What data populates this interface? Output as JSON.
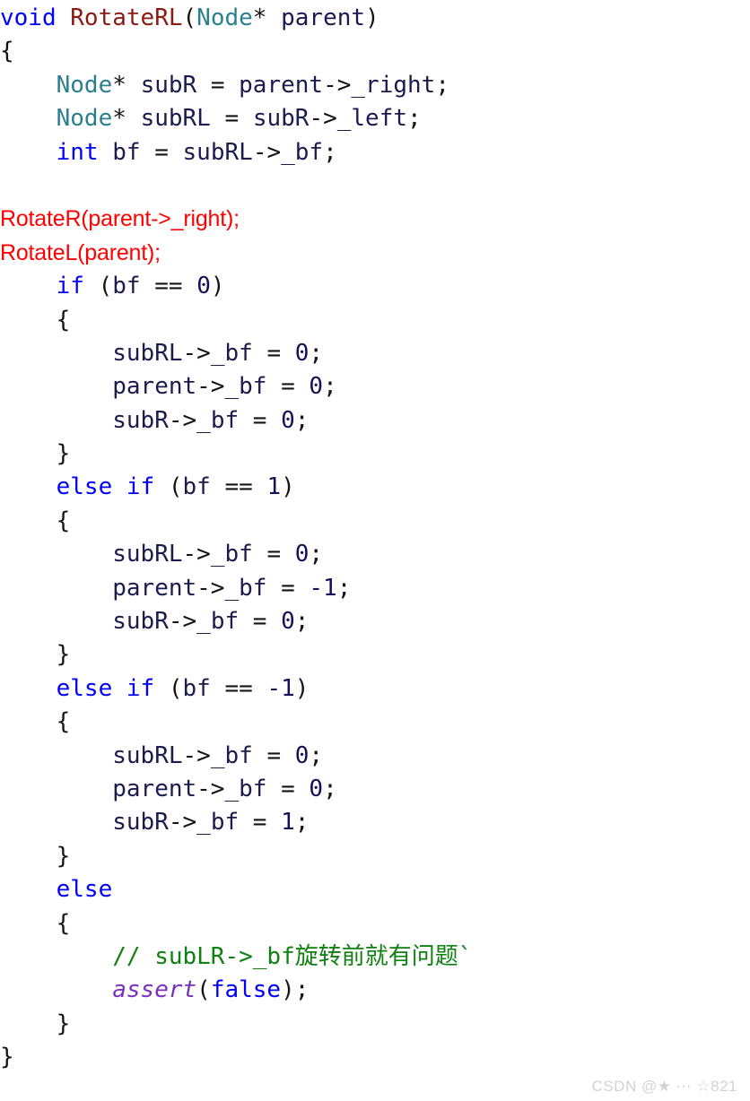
{
  "document": {
    "kind": "code-screenshot",
    "language": "C++",
    "function_name": "RotateRL",
    "background_color": "#ffffff"
  },
  "palette": {
    "keyword": "#0000ff",
    "function_name": "#8b1a12",
    "type_name": "#2b8090",
    "identifier": "#1b1b4f",
    "punctuation": "#141414",
    "number": "#121258",
    "comment": "#108010",
    "macro": "#7b2fbe",
    "annotation_red": "#ff0000",
    "watermark": "#d2d2d2"
  },
  "code": {
    "plain_text": "void RotateRL(Node* parent)\n{\n    Node* subR = parent->_right;\n    Node* subRL = subR->_left;\n    int bf = subRL->_bf;\n\n    RotateR(parent->_right);\n    RotateL(parent);\n    if (bf == 0)\n    {\n        subRL->_bf = 0;\n        parent->_bf = 0;\n        subR->_bf = 0;\n    }\n    else if (bf == 1)\n    {\n        subRL->_bf = 0;\n        parent->_bf = -1;\n        subR->_bf = 0;\n    }\n    else if (bf == -1)\n    {\n        subRL->_bf = 0;\n        parent->_bf = 0;\n        subR->_bf = 1;\n    }\n    else\n    {\n        // subLR->_bf旋转前就有问题`\n        assert(false);\n    }\n}",
    "lines": [
      {
        "n": 1,
        "style": "code",
        "tokens": [
          {
            "t": "void",
            "c": "kw"
          },
          {
            "t": " ",
            "c": "punct"
          },
          {
            "t": "RotateRL",
            "c": "fn"
          },
          {
            "t": "(",
            "c": "punct"
          },
          {
            "t": "Node",
            "c": "type"
          },
          {
            "t": "* ",
            "c": "punct"
          },
          {
            "t": "parent",
            "c": "ident"
          },
          {
            "t": ")",
            "c": "punct"
          }
        ]
      },
      {
        "n": 2,
        "style": "code",
        "tokens": [
          {
            "t": "{",
            "c": "punct"
          }
        ]
      },
      {
        "n": 3,
        "style": "code",
        "tokens": [
          {
            "t": "    ",
            "c": "punct"
          },
          {
            "t": "Node",
            "c": "type"
          },
          {
            "t": "* ",
            "c": "punct"
          },
          {
            "t": "subR",
            "c": "ident"
          },
          {
            "t": " = ",
            "c": "punct"
          },
          {
            "t": "parent",
            "c": "ident"
          },
          {
            "t": "->",
            "c": "punct"
          },
          {
            "t": "_right",
            "c": "ident"
          },
          {
            "t": ";",
            "c": "punct"
          }
        ]
      },
      {
        "n": 4,
        "style": "code",
        "tokens": [
          {
            "t": "    ",
            "c": "punct"
          },
          {
            "t": "Node",
            "c": "type"
          },
          {
            "t": "* ",
            "c": "punct"
          },
          {
            "t": "subRL",
            "c": "ident"
          },
          {
            "t": " = ",
            "c": "punct"
          },
          {
            "t": "subR",
            "c": "ident"
          },
          {
            "t": "->",
            "c": "punct"
          },
          {
            "t": "_left",
            "c": "ident"
          },
          {
            "t": ";",
            "c": "punct"
          }
        ]
      },
      {
        "n": 5,
        "style": "code",
        "tokens": [
          {
            "t": "    ",
            "c": "punct"
          },
          {
            "t": "int",
            "c": "kw"
          },
          {
            "t": " ",
            "c": "punct"
          },
          {
            "t": "bf",
            "c": "ident"
          },
          {
            "t": " = ",
            "c": "punct"
          },
          {
            "t": "subRL",
            "c": "ident"
          },
          {
            "t": "->",
            "c": "punct"
          },
          {
            "t": "_bf",
            "c": "ident"
          },
          {
            "t": ";",
            "c": "punct"
          }
        ]
      },
      {
        "n": 6,
        "style": "blank",
        "tokens": [
          {
            "t": " ",
            "c": "punct"
          }
        ]
      },
      {
        "n": 7,
        "style": "annotation",
        "tokens": [
          {
            "t": "RotateR(parent->_right);",
            "c": "red"
          }
        ]
      },
      {
        "n": 8,
        "style": "annotation",
        "tokens": [
          {
            "t": "RotateL(parent);",
            "c": "red"
          }
        ]
      },
      {
        "n": 9,
        "style": "code",
        "tokens": [
          {
            "t": "    ",
            "c": "punct"
          },
          {
            "t": "if",
            "c": "kw"
          },
          {
            "t": " (",
            "c": "punct"
          },
          {
            "t": "bf",
            "c": "ident"
          },
          {
            "t": " == ",
            "c": "punct"
          },
          {
            "t": "0",
            "c": "num"
          },
          {
            "t": ")",
            "c": "punct"
          }
        ]
      },
      {
        "n": 10,
        "style": "code",
        "tokens": [
          {
            "t": "    {",
            "c": "punct"
          }
        ]
      },
      {
        "n": 11,
        "style": "code",
        "tokens": [
          {
            "t": "        ",
            "c": "punct"
          },
          {
            "t": "subRL",
            "c": "ident"
          },
          {
            "t": "->",
            "c": "punct"
          },
          {
            "t": "_bf",
            "c": "ident"
          },
          {
            "t": " = ",
            "c": "punct"
          },
          {
            "t": "0",
            "c": "num"
          },
          {
            "t": ";",
            "c": "punct"
          }
        ]
      },
      {
        "n": 12,
        "style": "code",
        "tokens": [
          {
            "t": "        ",
            "c": "punct"
          },
          {
            "t": "parent",
            "c": "ident"
          },
          {
            "t": "->",
            "c": "punct"
          },
          {
            "t": "_bf",
            "c": "ident"
          },
          {
            "t": " = ",
            "c": "punct"
          },
          {
            "t": "0",
            "c": "num"
          },
          {
            "t": ";",
            "c": "punct"
          }
        ]
      },
      {
        "n": 13,
        "style": "code",
        "tokens": [
          {
            "t": "        ",
            "c": "punct"
          },
          {
            "t": "subR",
            "c": "ident"
          },
          {
            "t": "->",
            "c": "punct"
          },
          {
            "t": "_bf",
            "c": "ident"
          },
          {
            "t": " = ",
            "c": "punct"
          },
          {
            "t": "0",
            "c": "num"
          },
          {
            "t": ";",
            "c": "punct"
          }
        ]
      },
      {
        "n": 14,
        "style": "code",
        "tokens": [
          {
            "t": "    }",
            "c": "punct"
          }
        ]
      },
      {
        "n": 15,
        "style": "code",
        "tokens": [
          {
            "t": "    ",
            "c": "punct"
          },
          {
            "t": "else if",
            "c": "kw"
          },
          {
            "t": " (",
            "c": "punct"
          },
          {
            "t": "bf",
            "c": "ident"
          },
          {
            "t": " == ",
            "c": "punct"
          },
          {
            "t": "1",
            "c": "num"
          },
          {
            "t": ")",
            "c": "punct"
          }
        ]
      },
      {
        "n": 16,
        "style": "code",
        "tokens": [
          {
            "t": "    {",
            "c": "punct"
          }
        ]
      },
      {
        "n": 17,
        "style": "code",
        "tokens": [
          {
            "t": "        ",
            "c": "punct"
          },
          {
            "t": "subRL",
            "c": "ident"
          },
          {
            "t": "->",
            "c": "punct"
          },
          {
            "t": "_bf",
            "c": "ident"
          },
          {
            "t": " = ",
            "c": "punct"
          },
          {
            "t": "0",
            "c": "num"
          },
          {
            "t": ";",
            "c": "punct"
          }
        ]
      },
      {
        "n": 18,
        "style": "code",
        "tokens": [
          {
            "t": "        ",
            "c": "punct"
          },
          {
            "t": "parent",
            "c": "ident"
          },
          {
            "t": "->",
            "c": "punct"
          },
          {
            "t": "_bf",
            "c": "ident"
          },
          {
            "t": " = ",
            "c": "punct"
          },
          {
            "t": "-1",
            "c": "num"
          },
          {
            "t": ";",
            "c": "punct"
          }
        ]
      },
      {
        "n": 19,
        "style": "code",
        "tokens": [
          {
            "t": "        ",
            "c": "punct"
          },
          {
            "t": "subR",
            "c": "ident"
          },
          {
            "t": "->",
            "c": "punct"
          },
          {
            "t": "_bf",
            "c": "ident"
          },
          {
            "t": " = ",
            "c": "punct"
          },
          {
            "t": "0",
            "c": "num"
          },
          {
            "t": ";",
            "c": "punct"
          }
        ]
      },
      {
        "n": 20,
        "style": "code",
        "tokens": [
          {
            "t": "    }",
            "c": "punct"
          }
        ]
      },
      {
        "n": 21,
        "style": "code",
        "tokens": [
          {
            "t": "    ",
            "c": "punct"
          },
          {
            "t": "else if",
            "c": "kw"
          },
          {
            "t": " (",
            "c": "punct"
          },
          {
            "t": "bf",
            "c": "ident"
          },
          {
            "t": " == ",
            "c": "punct"
          },
          {
            "t": "-1",
            "c": "num"
          },
          {
            "t": ")",
            "c": "punct"
          }
        ]
      },
      {
        "n": 22,
        "style": "code",
        "tokens": [
          {
            "t": "    {",
            "c": "punct"
          }
        ]
      },
      {
        "n": 23,
        "style": "code",
        "tokens": [
          {
            "t": "        ",
            "c": "punct"
          },
          {
            "t": "subRL",
            "c": "ident"
          },
          {
            "t": "->",
            "c": "punct"
          },
          {
            "t": "_bf",
            "c": "ident"
          },
          {
            "t": " = ",
            "c": "punct"
          },
          {
            "t": "0",
            "c": "num"
          },
          {
            "t": ";",
            "c": "punct"
          }
        ]
      },
      {
        "n": 24,
        "style": "code",
        "tokens": [
          {
            "t": "        ",
            "c": "punct"
          },
          {
            "t": "parent",
            "c": "ident"
          },
          {
            "t": "->",
            "c": "punct"
          },
          {
            "t": "_bf",
            "c": "ident"
          },
          {
            "t": " = ",
            "c": "punct"
          },
          {
            "t": "0",
            "c": "num"
          },
          {
            "t": ";",
            "c": "punct"
          }
        ]
      },
      {
        "n": 25,
        "style": "code",
        "tokens": [
          {
            "t": "        ",
            "c": "punct"
          },
          {
            "t": "subR",
            "c": "ident"
          },
          {
            "t": "->",
            "c": "punct"
          },
          {
            "t": "_bf",
            "c": "ident"
          },
          {
            "t": " = ",
            "c": "punct"
          },
          {
            "t": "1",
            "c": "num"
          },
          {
            "t": ";",
            "c": "punct"
          }
        ]
      },
      {
        "n": 26,
        "style": "code",
        "tokens": [
          {
            "t": "    }",
            "c": "punct"
          }
        ]
      },
      {
        "n": 27,
        "style": "code",
        "tokens": [
          {
            "t": "    ",
            "c": "punct"
          },
          {
            "t": "else",
            "c": "kw"
          }
        ]
      },
      {
        "n": 28,
        "style": "code",
        "tokens": [
          {
            "t": "    {",
            "c": "punct"
          }
        ]
      },
      {
        "n": 29,
        "style": "code",
        "tokens": [
          {
            "t": "        ",
            "c": "punct"
          },
          {
            "t": "// subLR->_bf旋转前就有问题`",
            "c": "comment"
          }
        ]
      },
      {
        "n": 30,
        "style": "code",
        "tokens": [
          {
            "t": "        ",
            "c": "punct"
          },
          {
            "t": "assert",
            "c": "macro"
          },
          {
            "t": "(",
            "c": "punct"
          },
          {
            "t": "false",
            "c": "kw"
          },
          {
            "t": ");",
            "c": "punct"
          }
        ]
      },
      {
        "n": 31,
        "style": "code",
        "tokens": [
          {
            "t": "    }",
            "c": "punct"
          }
        ]
      },
      {
        "n": 32,
        "style": "code",
        "tokens": [
          {
            "t": "}",
            "c": "punct"
          }
        ]
      }
    ]
  },
  "watermark": {
    "text": "CSDN @★ ⋯ ☆821"
  }
}
